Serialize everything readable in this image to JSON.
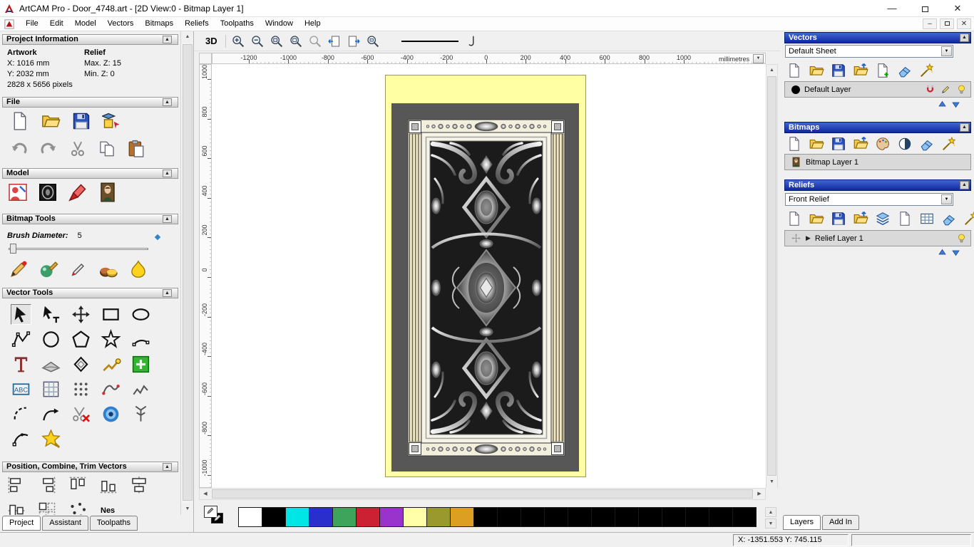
{
  "window": {
    "title": "ArtCAM Pro - Door_4748.art - [2D View:0 - Bitmap Layer 1]"
  },
  "menubar": {
    "items": [
      "File",
      "Edit",
      "Model",
      "Vectors",
      "Bitmaps",
      "Reliefs",
      "Toolpaths",
      "Window",
      "Help"
    ]
  },
  "left_panel": {
    "project_information": {
      "header": "Project Information",
      "artwork_label": "Artwork",
      "relief_label": "Relief",
      "x": "X: 1016 mm",
      "y": "Y: 2032 mm",
      "max_z": "Max. Z: 15",
      "min_z": "Min. Z: 0",
      "pixels": "2828 x 5656 pixels"
    },
    "file": {
      "header": "File",
      "row1": [
        "new-model-icon",
        "open-file-icon",
        "save-file-icon",
        "import-model-icon"
      ],
      "row2": [
        "undo-icon",
        "redo-icon",
        "cut-icon",
        "copy-icon",
        "paste-icon"
      ]
    },
    "model": {
      "header": "Model",
      "icons": [
        "edit-model-icon",
        "greyscale-view-icon",
        "sculpt-icon",
        "load-image-icon"
      ]
    },
    "bitmap_tools": {
      "header": "Bitmap Tools",
      "brush_label": "Brush Diameter:",
      "brush_value": "5",
      "icons": [
        "paint-icon",
        "paint-selective-icon",
        "draw-icon",
        "colour-palette-icon",
        "flood-fill-icon"
      ]
    },
    "vector_tools": {
      "header": "Vector Tools",
      "tools": [
        "select-vectors-tool",
        "node-editing-tool",
        "transform-vectors-tool",
        "rectangle-tool",
        "ellipse-tool",
        "polyline-tool",
        "circle-tool",
        "polygon-tool",
        "star-tool",
        "arc-tool",
        "text-tool",
        "measure-tool",
        "offset-vector-tool",
        "bitmap-to-vector-tool",
        "paste-vector-tool",
        "text-block-tool",
        "paste-along-curve-tool",
        "block-paste-tool",
        "nesting-tool",
        "fit-arcs-tool",
        "join-vectors-tool",
        "extend-vector-tool",
        "trim-vectors-tool",
        "create-spiral-tool",
        "fit-curve-tool",
        "section-vector-tool",
        "vector-doctor-tool"
      ]
    },
    "position_section": {
      "header": "Position, Combine, Trim Vectors",
      "row1": [
        "align-left-icon",
        "align-right-icon",
        "align-top-icon",
        "align-bottom-icon",
        "align-centre-icon"
      ],
      "row2": [
        "align-stack-icon",
        "array-copy-icon",
        "scatter-icon"
      ],
      "nest_label": "Nes"
    },
    "tabs": [
      {
        "label": "Project",
        "active": true
      },
      {
        "label": "Assistant",
        "active": false
      },
      {
        "label": "Toolpaths",
        "active": false
      }
    ]
  },
  "canvas": {
    "toolbar": {
      "view_button": "3D",
      "icons": [
        "zoom-in-icon",
        "zoom-out-icon",
        "zoom-box-icon",
        "zoom-fit-icon",
        "zoom-previous-icon",
        "pan-left-icon",
        "pan-right-icon",
        "zoom-window-icon"
      ],
      "icons_right": [
        "smooth-curve-icon"
      ]
    },
    "rulers": {
      "units": "millimetres",
      "h_ticks": [
        -1200,
        -1000,
        -800,
        -600,
        -400,
        -200,
        0,
        200,
        400,
        600,
        800,
        1000
      ],
      "v_ticks": [
        1000,
        800,
        600,
        400,
        200,
        0,
        -200,
        -400,
        -600,
        -800,
        -1000
      ]
    }
  },
  "palette": {
    "primary": "#ffffff",
    "secondary": "#000000",
    "swatches": [
      "#ffffff",
      "#000000",
      "#00e5e5",
      "#2a2ecc",
      "#3fa45b",
      "#cc2033",
      "#9933cc",
      "#ffffaa",
      "#99992e",
      "#dd9f22",
      "#000000",
      "#000000",
      "#000000",
      "#000000",
      "#000000",
      "#000000",
      "#000000",
      "#000000",
      "#000000",
      "#000000",
      "#000000",
      "#000000"
    ]
  },
  "right_panel": {
    "vectors": {
      "header": "Vectors",
      "sheet": "Default Sheet",
      "toolbar": [
        "new-vector-layer-icon",
        "open-vector-layer-icon",
        "save-vector-layer-icon",
        "import-vectors-icon",
        "new-sheet-icon",
        "delete-layer-icon",
        "layer-wizard-icon"
      ],
      "layer": {
        "name": "Default Layer",
        "icons": [
          "snap-magnet-icon",
          "edit-colour-icon",
          "visibility-bulb-icon"
        ]
      },
      "order_icons": [
        "move-layer-up-icon",
        "move-layer-down-icon"
      ]
    },
    "bitmaps": {
      "header": "Bitmaps",
      "toolbar": [
        "new-bitmap-layer-icon",
        "open-bitmap-layer-icon",
        "save-bitmap-layer-icon",
        "import-bitmap-icon",
        "bitmap-options-icon",
        "contrast-icon",
        "delete-bitmap-layer-icon",
        "bitmap-wizard-icon"
      ],
      "layer": {
        "name": "Bitmap Layer 1",
        "icons": [
          "bitmap-thumbnail-icon"
        ]
      }
    },
    "reliefs": {
      "header": "Reliefs",
      "relief": "Front Relief",
      "toolbar": [
        "new-relief-layer-icon",
        "open-relief-layer-icon",
        "save-relief-layer-icon",
        "import-relief-icon",
        "relief-stack-icon",
        "relief-sheet-icon",
        "relief-grid-icon",
        "delete-relief-layer-icon",
        "relief-wizard-icon"
      ],
      "layer": {
        "name": "Relief Layer 1",
        "icons": [
          "visibility-bulb-icon"
        ]
      },
      "order_icons": [
        "move-layer-up-icon",
        "move-layer-down-icon"
      ]
    },
    "tabs": [
      {
        "label": "Layers",
        "active": true
      },
      {
        "label": "Add In",
        "active": false
      }
    ]
  },
  "status_bar": {
    "coordinates": "X: -1351.553 Y: 745.115"
  }
}
